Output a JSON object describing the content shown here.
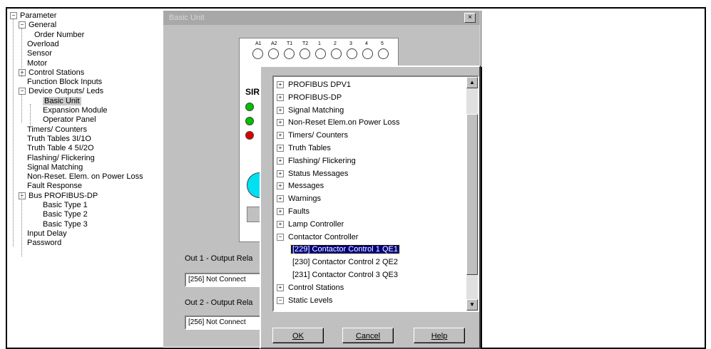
{
  "tree": {
    "items": [
      {
        "label": "Parameter",
        "expander": "−"
      },
      {
        "label": "General",
        "expander": "−"
      },
      {
        "label": "Order Number"
      },
      {
        "label": "Overload"
      },
      {
        "label": "Sensor"
      },
      {
        "label": "Motor"
      },
      {
        "label": "Control Stations",
        "expander": "+"
      },
      {
        "label": "Function Block Inputs"
      },
      {
        "label": "Device Outputs/ Leds",
        "expander": "−"
      },
      {
        "label": "Basic Unit",
        "selected": true
      },
      {
        "label": "Expansion Module"
      },
      {
        "label": "Operator Panel"
      },
      {
        "label": "Timers/ Counters"
      },
      {
        "label": "Truth Tables 3I/1O"
      },
      {
        "label": "Truth Table 4 5I/2O"
      },
      {
        "label": "Flashing/ Flickering"
      },
      {
        "label": "Signal Matching"
      },
      {
        "label": "Non-Reset. Elem. on Power Loss"
      },
      {
        "label": "Fault Response"
      },
      {
        "label": "Bus PROFIBUS-DP",
        "expander": "−"
      },
      {
        "label": "Basic Type 1"
      },
      {
        "label": "Basic Type 2"
      },
      {
        "label": "Basic Type 3"
      },
      {
        "label": "Input Delay"
      },
      {
        "label": "Password"
      }
    ]
  },
  "basic_unit_window": {
    "title": "Basic Unit",
    "close_glyph": "×",
    "terminals": [
      "A1",
      "A2",
      "T1",
      "T2",
      "1",
      "2",
      "3",
      "4",
      "5"
    ],
    "brand": "SIR",
    "out1_label": "Out 1 - Output Rela",
    "out1_value": "[256] Not Connect",
    "out2_label": "Out 2 - Output Rela",
    "out2_value": "[256] Not Connect",
    "led_colors": [
      "#00c000",
      "#00c000",
      "#e00000"
    ],
    "button_color": "#00e0f0"
  },
  "selector": {
    "items": [
      {
        "label": "PROFIBUS DPV1",
        "expander": "+"
      },
      {
        "label": "PROFIBUS-DP",
        "expander": "+"
      },
      {
        "label": "Signal Matching",
        "expander": "+"
      },
      {
        "label": "Non-Reset Elem.on Power Loss",
        "expander": "+"
      },
      {
        "label": "Timers/ Counters",
        "expander": "+"
      },
      {
        "label": "Truth Tables",
        "expander": "+"
      },
      {
        "label": "Flashing/ Flickering",
        "expander": "+"
      },
      {
        "label": "Status Messages",
        "expander": "+"
      },
      {
        "label": "Messages",
        "expander": "+"
      },
      {
        "label": "Warnings",
        "expander": "+"
      },
      {
        "label": "Faults",
        "expander": "+"
      },
      {
        "label": "Lamp Controller",
        "expander": "+"
      },
      {
        "label": "Contactor Controller",
        "expander": "−"
      },
      {
        "label": "[229] Contactor Control 1 QE1",
        "child": true,
        "selected": true
      },
      {
        "label": "[230] Contactor Control 2 QE2",
        "child": true
      },
      {
        "label": "[231] Contactor Control 3 QE3",
        "child": true
      },
      {
        "label": "Control Stations",
        "expander": "+"
      },
      {
        "label": "Static Levels",
        "expander": "−"
      }
    ],
    "ok_label": "OK",
    "cancel_label": "Cancel",
    "help_label": "Help"
  }
}
